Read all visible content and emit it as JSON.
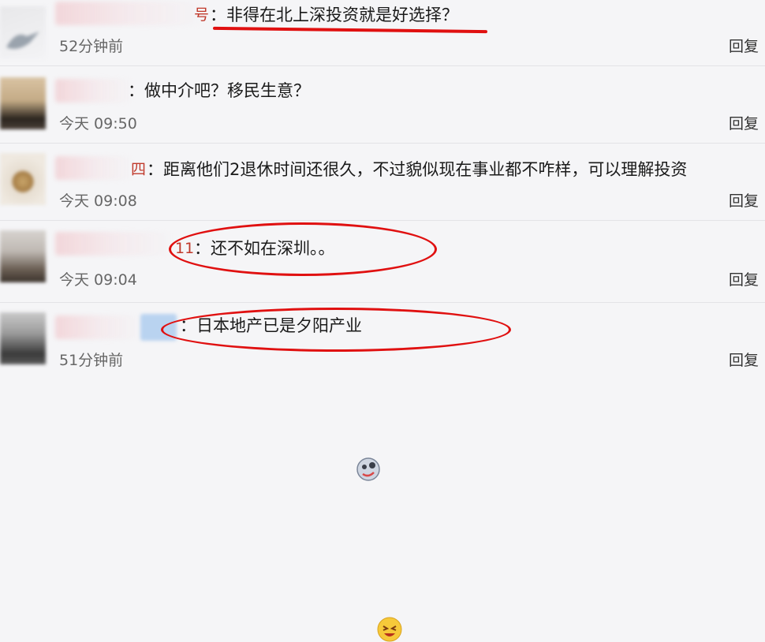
{
  "comments": [
    {
      "name_tail": "号",
      "text": "：非得在北上深投资就是好选择？",
      "time": "52分钟前",
      "reply": "回复"
    },
    {
      "name_tail": "",
      "text": "：做中介吧？移民生意？",
      "time": "今天 09:50",
      "reply": "回复"
    },
    {
      "name_tail": "四",
      "text": "：距离他们2退休时间还很久，不过貌似现在事业都不咋样，可以理解投资",
      "time": "今天 09:08",
      "reply": "回复"
    },
    {
      "name_tail": "11",
      "text": "：还不如在深圳。。",
      "time": "今天 09:04",
      "reply": "回复"
    },
    {
      "name_tail": "",
      "text": "：日本地产已是夕阳产业",
      "time": "51分钟前",
      "reply": "回复"
    }
  ],
  "colors": {
    "annotation": "#e01010",
    "name_accent": "#c0392b"
  },
  "icons": [
    "face-emoji-icon",
    "grin-emoji-icon"
  ]
}
